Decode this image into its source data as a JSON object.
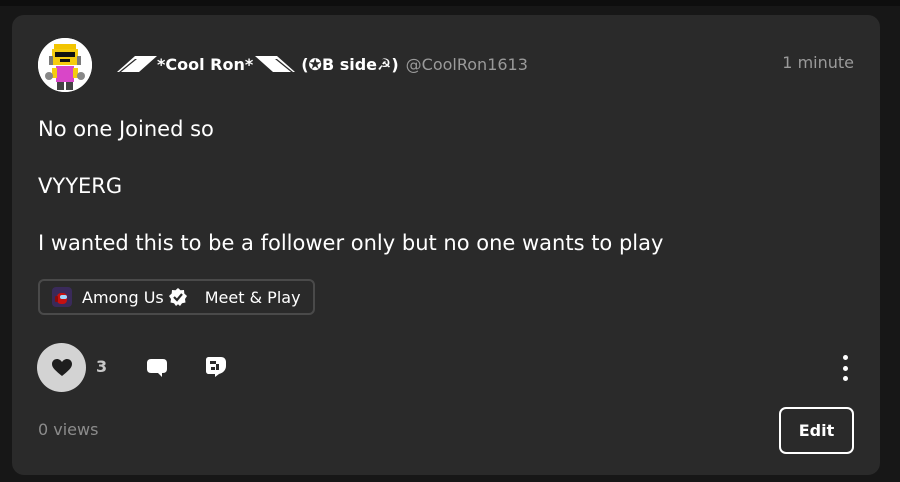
{
  "post": {
    "author": {
      "display_name_left_deco": "◢◤",
      "display_name": "*Cool Ron*",
      "display_name_right_deco": "◥◣",
      "display_name_suffix": "(✪B side☭)",
      "handle": "@CoolRon1613",
      "avatar_icon": "robot-avatar-icon"
    },
    "timestamp": "1 minute",
    "body_lines": [
      "No one Joined so",
      "VYYERG",
      "I wanted this to be a follower only but no one wants to play"
    ],
    "tag": {
      "game_icon": "among-us-game-icon",
      "game_name": "Among Us",
      "verified_icon": "verified-badge-icon",
      "category": "Meet & Play"
    },
    "actions": {
      "like_icon": "heart-icon",
      "like_count": "3",
      "comment_icon": "comment-icon",
      "share_icon": "share-icon",
      "more_icon": "more-vertical-icon"
    },
    "views": "0 views",
    "edit_label": "Edit"
  },
  "colors": {
    "page_bg": "#171717",
    "card_bg": "#2a2a2a",
    "text_primary": "#ffffff",
    "text_secondary": "#9a9a9a",
    "like_button_bg": "#d3d3d3"
  }
}
